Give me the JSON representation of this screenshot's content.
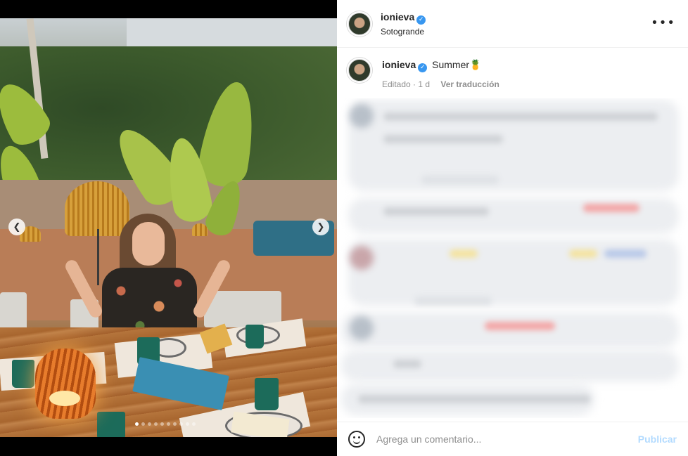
{
  "post": {
    "username": "ionieva",
    "location": "Sotogrande",
    "caption": "Summer",
    "caption_emoji": "🍍",
    "edited_label": "Editado",
    "age": "1 d",
    "translate_label": "Ver traducción",
    "carousel": {
      "total_slides": 10,
      "active_slide": 1
    }
  },
  "icons": {
    "verified": "verified-badge-icon",
    "more": "more-options-icon",
    "prev": "chevron-left-icon",
    "next": "chevron-right-icon",
    "emoji": "emoji-smile-icon"
  },
  "compose": {
    "placeholder": "Agrega un comentario...",
    "publish_label": "Publicar"
  },
  "colors": {
    "verified": "#3897f0",
    "publish_disabled": "#b3dbff",
    "secondary_text": "#8e8e8e"
  }
}
